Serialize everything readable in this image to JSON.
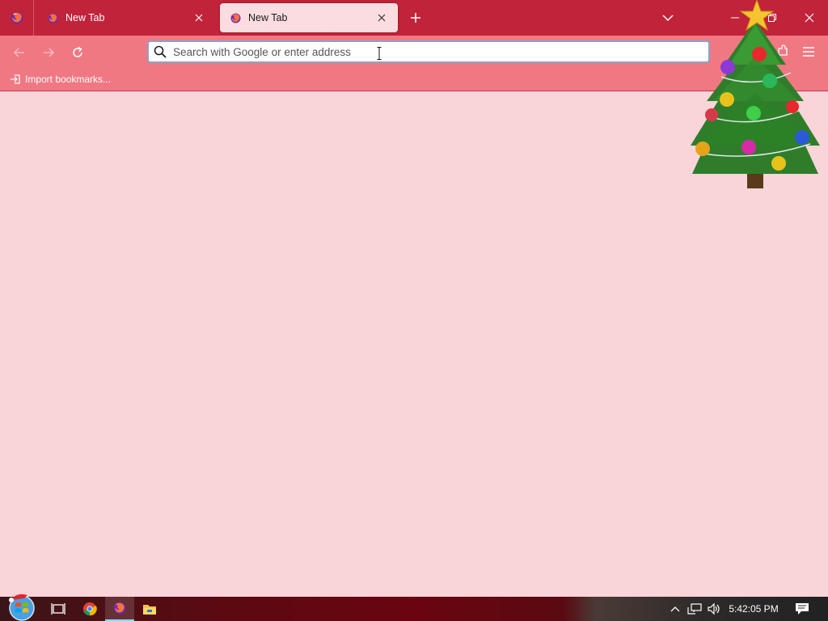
{
  "browser": {
    "tabs": [
      {
        "label": "New Tab",
        "active": false
      },
      {
        "label": "New Tab",
        "active": true
      }
    ],
    "urlbar": {
      "placeholder": "Search with Google or enter address",
      "value": ""
    },
    "bookmarks": [
      {
        "label": "Import bookmarks..."
      }
    ]
  },
  "taskbar": {
    "clock": "5:42:05 PM",
    "pinned": [
      "chrome-icon",
      "firefox-icon",
      "file-explorer-icon"
    ]
  },
  "colors": {
    "tabstrip": "#c1233a",
    "toolbar": "#f07883",
    "active_tab": "#fbdde1",
    "content": "#f9d5da"
  }
}
